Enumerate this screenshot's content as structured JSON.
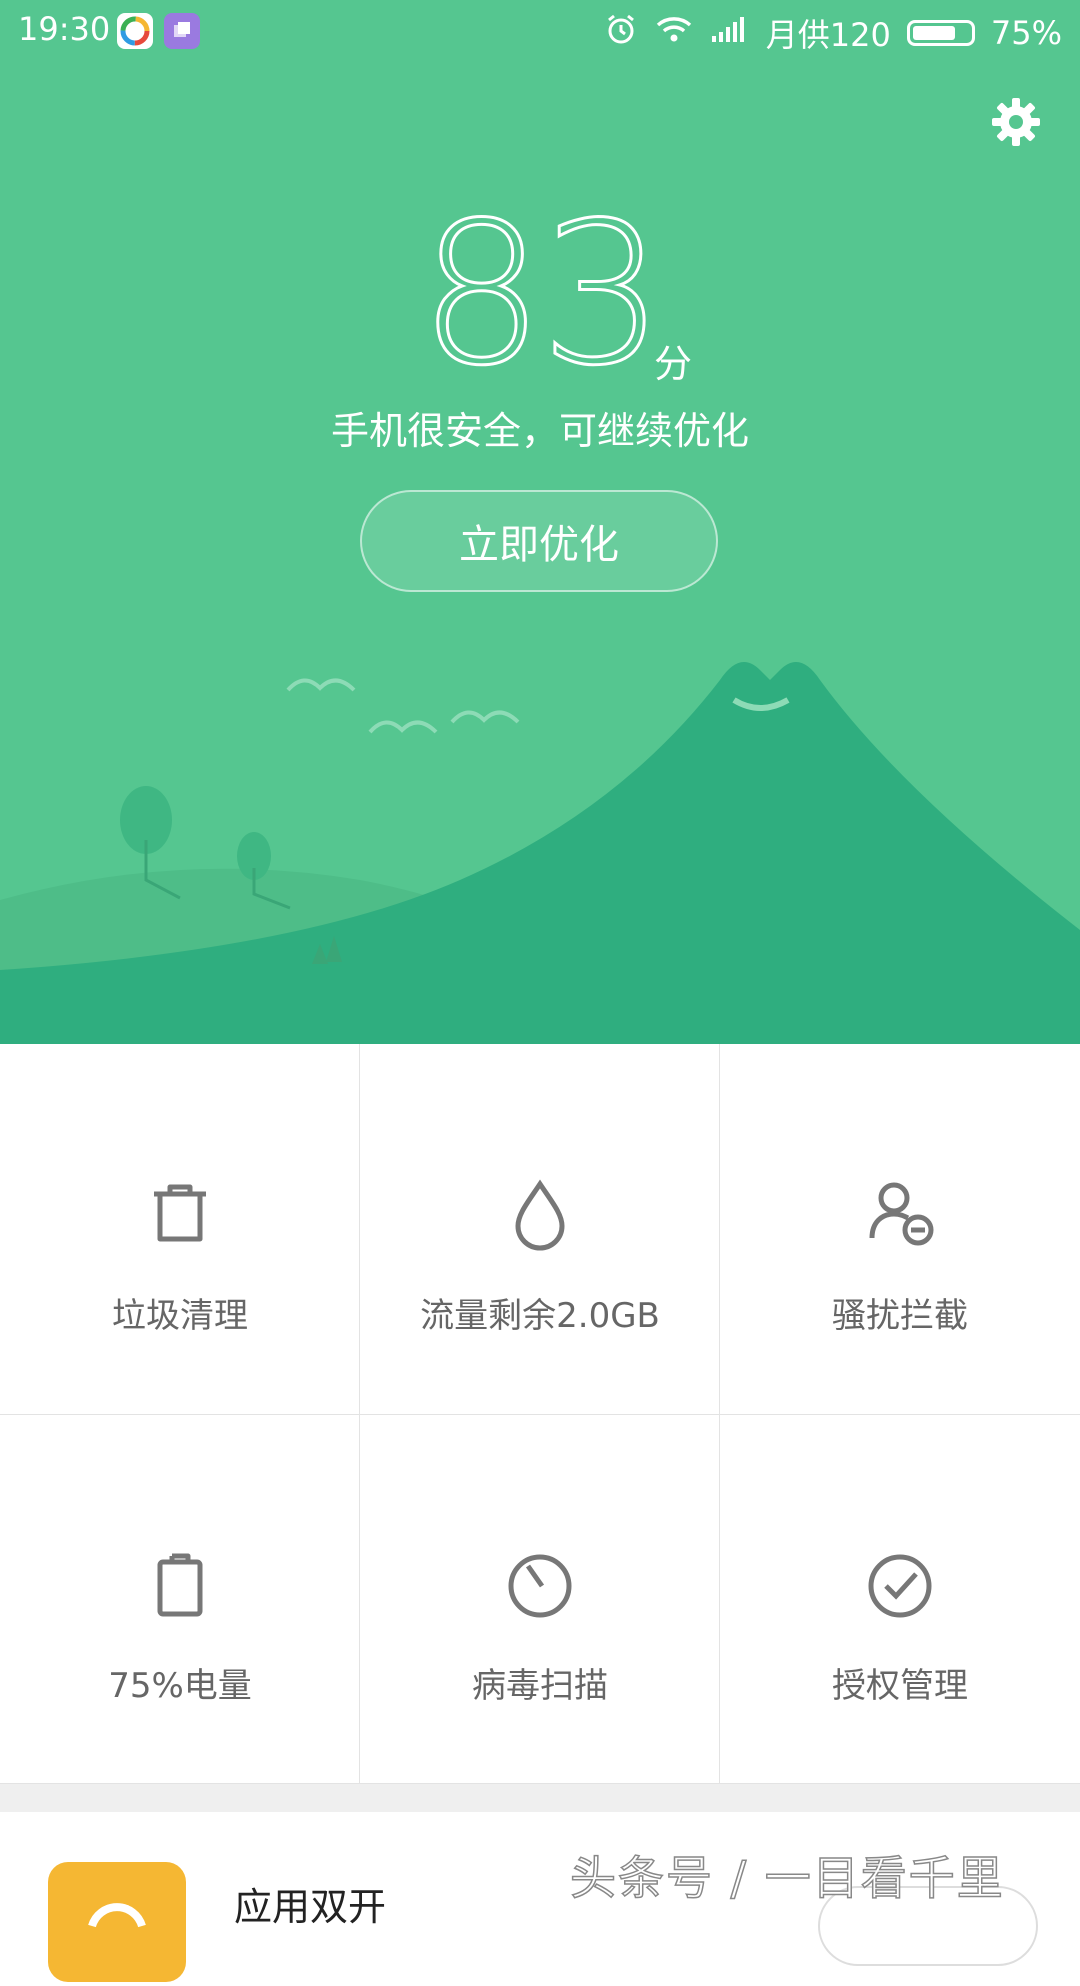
{
  "status_bar": {
    "time": "19:30",
    "carrier": "月供120",
    "battery_text": "75%",
    "battery_level": 0.75
  },
  "hero": {
    "score": "83",
    "score_unit": "分",
    "message": "手机很安全，可继续优化",
    "optimize_label": "立即优化",
    "bg_color": "#55c690",
    "mountain_color": "#2fae7f"
  },
  "features": [
    {
      "label": "垃圾清理",
      "icon": "trash-icon"
    },
    {
      "label": "流量剩余2.0GB",
      "icon": "droplet-icon"
    },
    {
      "label": "骚扰拦截",
      "icon": "user-block-icon"
    },
    {
      "label": "75%电量",
      "icon": "battery-icon"
    },
    {
      "label": "病毒扫描",
      "icon": "scan-icon"
    },
    {
      "label": "授权管理",
      "icon": "check-circle-icon"
    }
  ],
  "promo": {
    "title": "应用双开",
    "icon": "app-dual-icon"
  },
  "watermark": "头条号 / 一目看千里"
}
